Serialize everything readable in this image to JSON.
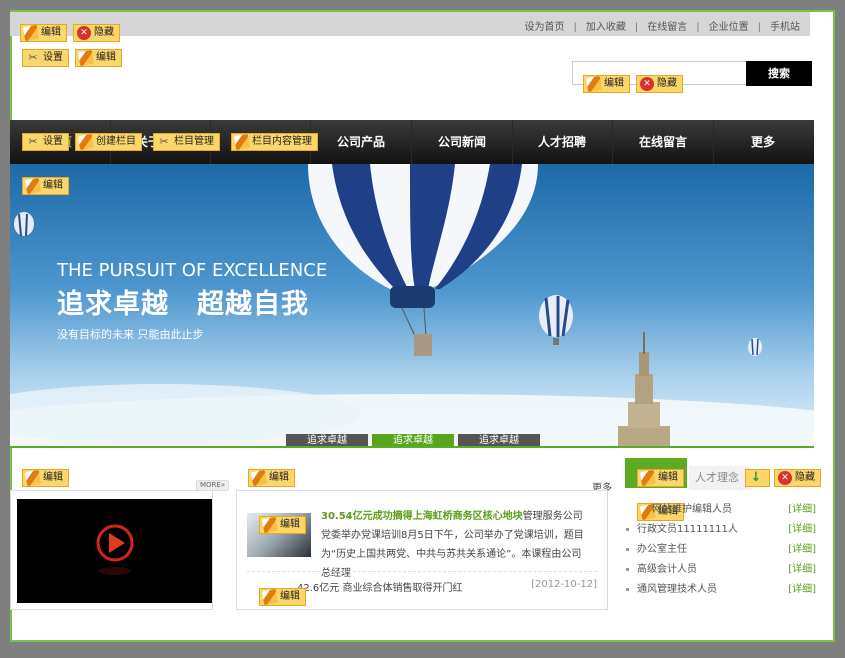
{
  "top_links": [
    "设为首页",
    "加入收藏",
    "在线留言",
    "企业位置",
    "手机站"
  ],
  "edit_tags": {
    "edit": "编辑",
    "hide": "隐藏",
    "settings": "设置",
    "create_column": "创建栏目",
    "column_manage": "栏目管理",
    "column_content_manage": "栏目内容管理"
  },
  "search": {
    "button": "搜索",
    "placeholder": ""
  },
  "nav": [
    {
      "label": "首页",
      "active": true
    },
    {
      "label": "关于我们",
      "active": false
    },
    {
      "label": "服务项目",
      "active": false
    },
    {
      "label": "公司产品",
      "active": false
    },
    {
      "label": "公司新闻",
      "active": false
    },
    {
      "label": "人才招聘",
      "active": false
    },
    {
      "label": "在线留言",
      "active": false
    },
    {
      "label": "更多",
      "active": false
    }
  ],
  "banner": {
    "en": "THE PURSUIT OF EXCELLENCE",
    "zh": "追求卓越　超越自我",
    "sub": "没有目标的未来  只能由此止步",
    "tabs": [
      {
        "label": "追求卓越",
        "active": false
      },
      {
        "label": "追求卓越",
        "active": true
      },
      {
        "label": "追求卓越",
        "active": false
      }
    ]
  },
  "sections": {
    "video_more": "MORE»",
    "news_more": "更多",
    "news": {
      "headline": "30.54亿元成功摘得上海虹桥商务区核心地块",
      "body": "管理服务公司党委举办党课培训8月5日下午，公司举办了党课培训，题目为“历史上国共两党、中共与苏共关系通论”。本课程由公司总经理",
      "row2": "42.6亿元 商业综合体销售取得开门红",
      "row2_date": "[2012-10-12]"
    },
    "jobs_tab_other": "人才理念",
    "jobs": [
      {
        "title": "网站维护编辑人员",
        "detail": "[详细]"
      },
      {
        "title": "行政文员11111111人",
        "detail": "[详细]"
      },
      {
        "title": "办公室主任",
        "detail": "[详细]"
      },
      {
        "title": "高级会计人员",
        "detail": "[详细]"
      },
      {
        "title": "通风管理技术人员",
        "detail": "[详细]"
      }
    ]
  },
  "colors": {
    "accent_green": "#7cc04a",
    "nav_bg": "#1a1a1a",
    "tag_bg": "#fbd66a",
    "hide_red": "#d9322a"
  }
}
